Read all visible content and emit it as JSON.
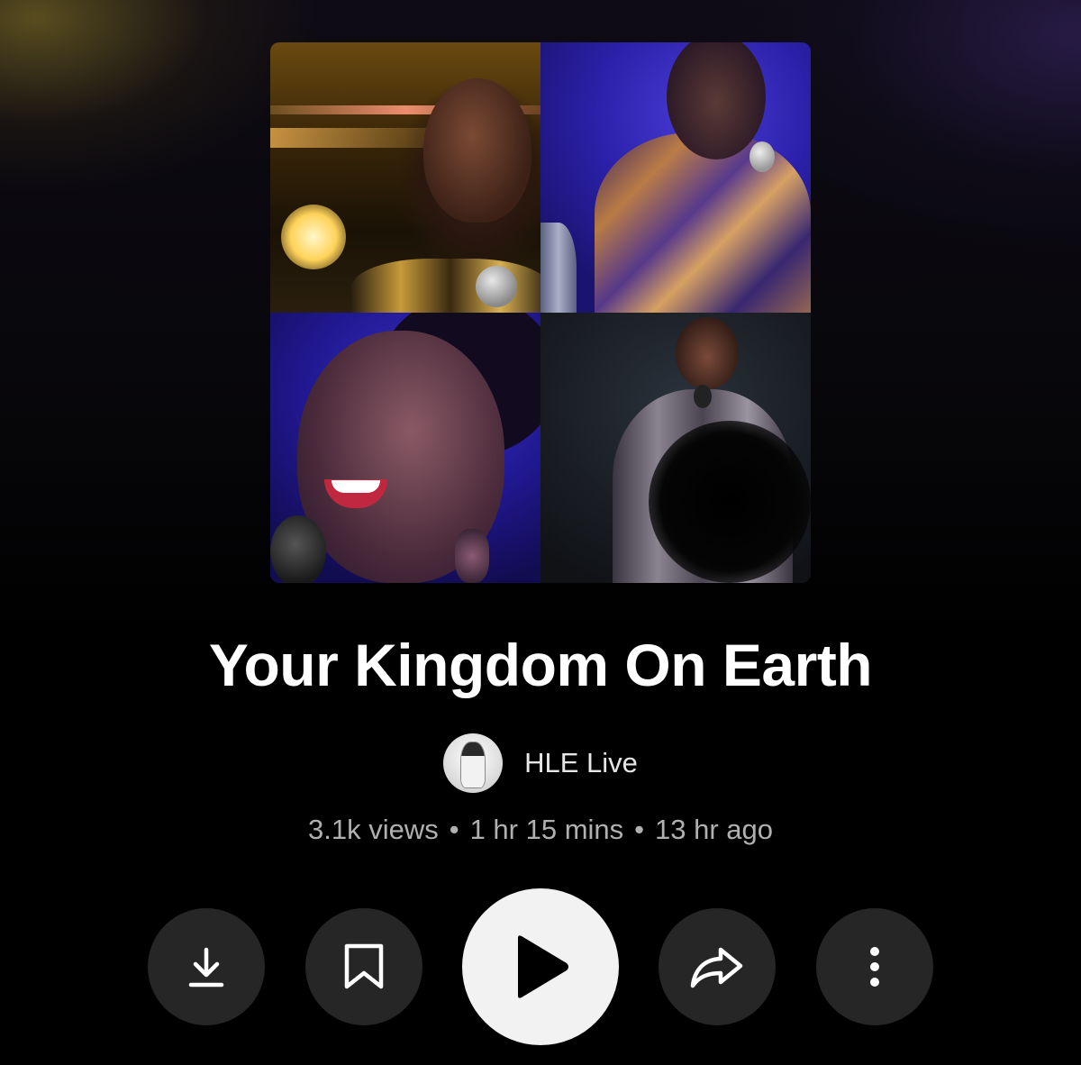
{
  "episode": {
    "title": "Your Kingdom On Earth",
    "channel_name": "HLE Live",
    "views": "3.1k views",
    "duration": "1 hr 15 mins",
    "posted": "13 hr ago",
    "separator": "•"
  },
  "actions": {
    "download_icon": "download-icon",
    "save_icon": "bookmark-icon",
    "play_icon": "play-icon",
    "share_icon": "share-icon",
    "more_icon": "more-vertical-icon"
  },
  "colors": {
    "background": "#000000",
    "button_bg": "#262626",
    "play_button_bg": "#f2f2f2",
    "meta_text": "#b0b0b0"
  }
}
